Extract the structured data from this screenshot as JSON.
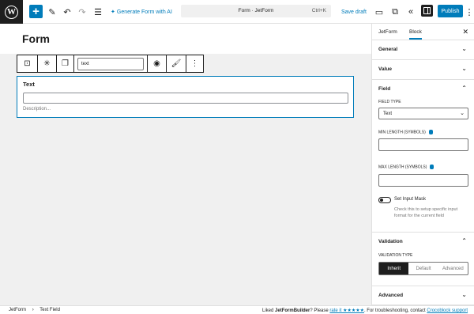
{
  "toolbar": {
    "plus_label": "+",
    "ai_label": "Generate Form with AI",
    "command_title": "Form · JetForm",
    "command_shortcut": "Ctrl+K",
    "save_draft": "Save draft",
    "publish": "Publish",
    "icons": [
      "wordpress-logo",
      "pencil-icon",
      "undo-icon",
      "redo-icon",
      "list-view-icon",
      "sparkle-icon",
      "desktop-preview-icon",
      "external-link-icon",
      "chevrons-left-icon",
      "sidebar-toggle-icon",
      "more-options-icon"
    ]
  },
  "editor": {
    "title": "Form",
    "block_toolbar": {
      "input_value": "text",
      "icons": [
        "field-type-icon",
        "asterisk-icon",
        "copy-icon",
        "eye-icon",
        "brush-icon",
        "more-vertical-icon"
      ]
    },
    "field": {
      "label": "Text",
      "description": "Description..."
    }
  },
  "sidebar": {
    "tabs": [
      "JetForm",
      "Block"
    ],
    "active_tab": "Block",
    "panels": {
      "general": "General",
      "value": "Value",
      "field": "Field",
      "validation": "Validation",
      "advanced": "Advanced"
    },
    "field_type_label": "FIELD TYPE",
    "field_type_value": "Text",
    "min_length_label": "MIN LENGTH (SYMBOLS)",
    "max_length_label": "MAX LENGTH (SYMBOLS)",
    "input_mask_label": "Set Input Mask",
    "input_mask_help": "Check this to setup specific input format for the current field",
    "validation_type_label": "VALIDATION TYPE",
    "validation_options": [
      "Inherit",
      "Default",
      "Advanced"
    ],
    "validation_selected": "Inherit"
  },
  "statusbar": {
    "crumb_root": "JetForm",
    "crumb_sep": "›",
    "crumb_leaf": "Text Field",
    "notice_prefix": "Liked ",
    "notice_brand": "JetFormBuilder",
    "notice_mid": "? Please ",
    "notice_rate": "rate it ★★★★★",
    "notice_after": ". For troubleshooting, contact ",
    "notice_support": "Crocoblock support"
  },
  "colors": {
    "accent": "#007cba",
    "dark": "#1e1e1e",
    "canvas": "#f0f0f0"
  }
}
